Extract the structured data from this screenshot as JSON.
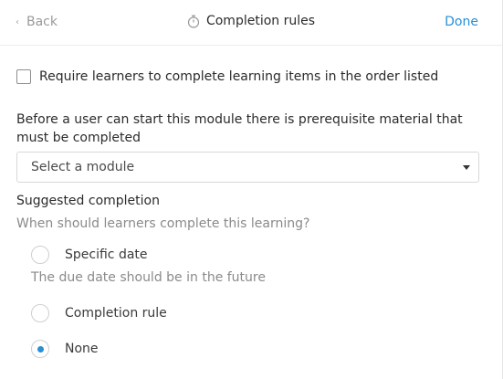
{
  "header": {
    "back_label": "Back",
    "title": "Completion rules",
    "done_label": "Done"
  },
  "order_rule": {
    "label": "Require learners to complete learning items in the order listed",
    "checked": false
  },
  "prerequisite": {
    "description": "Before a user can start this module there is prerequisite material that must be completed",
    "select_value": "Select a module"
  },
  "suggested_completion": {
    "title": "Suggested completion",
    "question": "When should learners complete this learning?",
    "options": [
      {
        "label": "Specific date",
        "checked": false
      },
      {
        "label": "Completion rule",
        "checked": false
      },
      {
        "label": "None",
        "checked": true
      }
    ],
    "date_hint": "The due date should be in the future"
  },
  "colors": {
    "accent": "#2a8fd6",
    "muted_text": "#8a8a8a"
  }
}
